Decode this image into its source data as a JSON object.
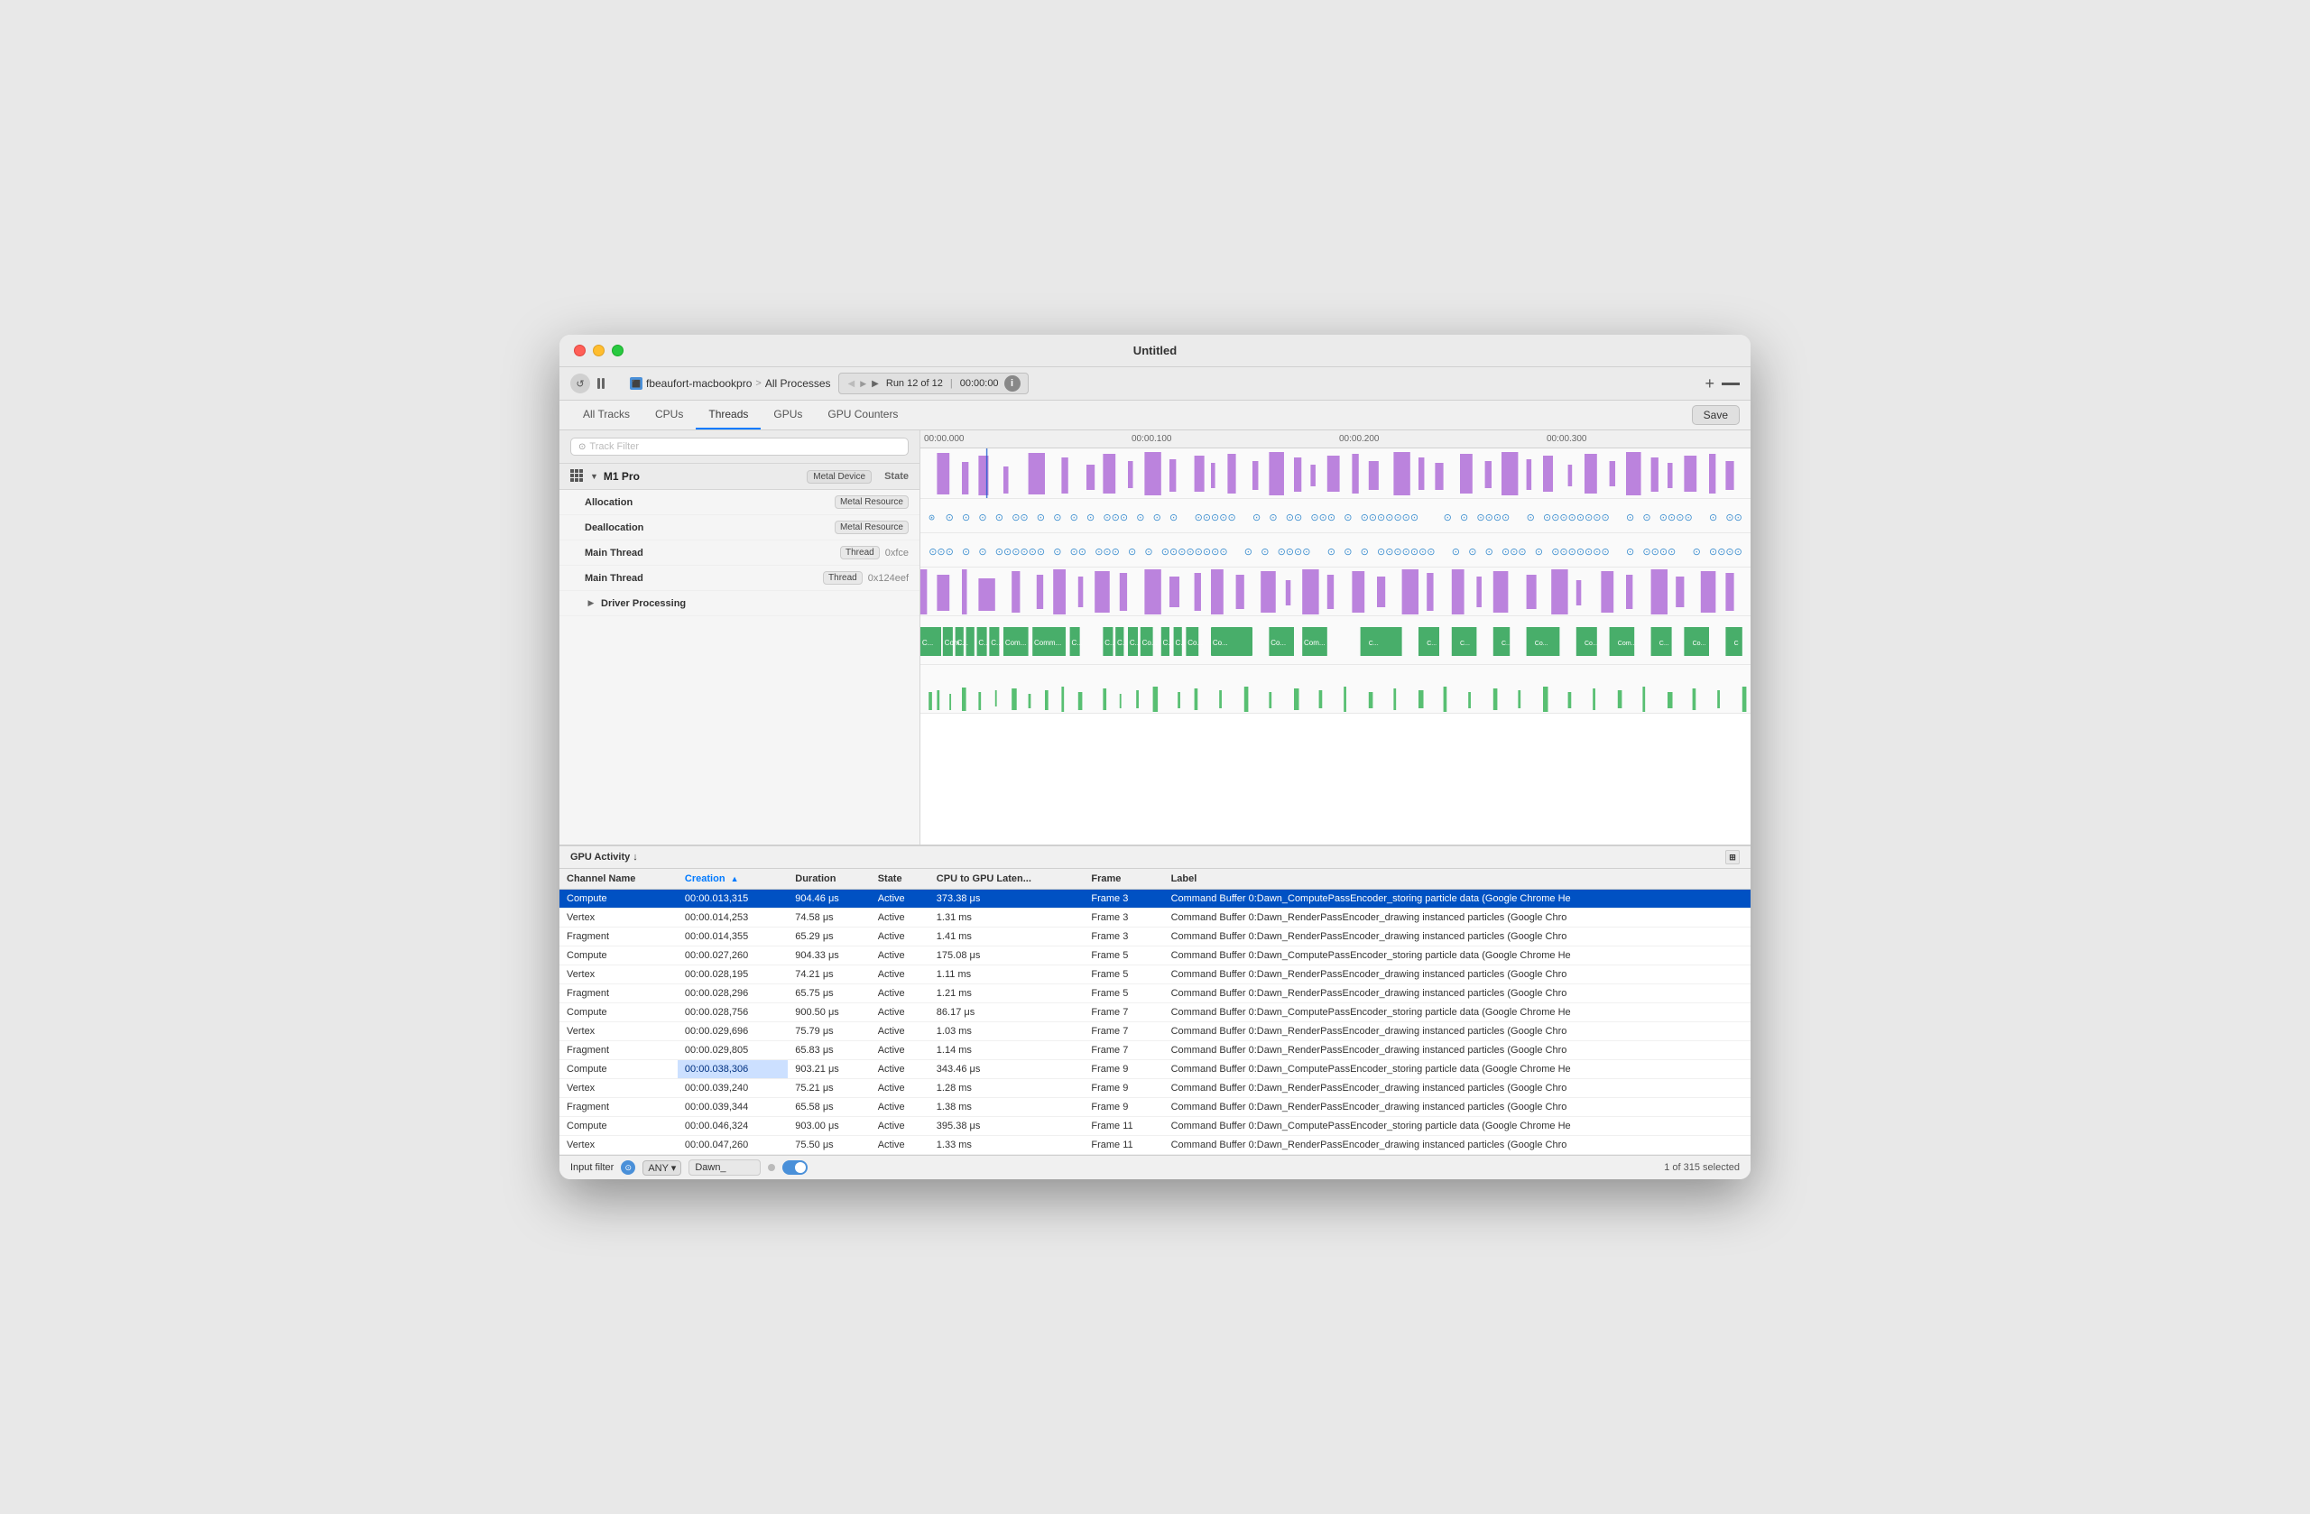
{
  "window": {
    "title": "Untitled"
  },
  "toolbar": {
    "device": "fbeaufort-macbookpro",
    "separator": ">",
    "process": "All Processes",
    "run_nav_left": "◀",
    "run_nav_right": "▶",
    "run_label": "Run 12 of 12",
    "time_label": "00:00:00",
    "plus_label": "+",
    "save_label": "Save"
  },
  "tabs": {
    "items": [
      {
        "label": "All Tracks",
        "active": false
      },
      {
        "label": "CPUs",
        "active": false
      },
      {
        "label": "Threads",
        "active": true
      },
      {
        "label": "GPUs",
        "active": false
      },
      {
        "label": "GPU Counters",
        "active": false
      }
    ]
  },
  "sidebar": {
    "track_filter_placeholder": "Track Filter",
    "state_label": "State",
    "m1_label": "M1 Pro",
    "metal_device_badge": "Metal Device",
    "rows": [
      {
        "title": "Allocation",
        "tag": "Metal Resource",
        "extra": ""
      },
      {
        "title": "Deallocation",
        "tag": "Metal Resource",
        "extra": ""
      },
      {
        "title": "Main Thread",
        "tag": "Thread",
        "extra": "0xfce"
      },
      {
        "title": "Main Thread",
        "tag": "Thread",
        "extra": "0x124eef"
      },
      {
        "title": "Driver Processing",
        "tag": "",
        "extra": ""
      }
    ]
  },
  "timeline": {
    "markers": [
      "00:00.000",
      "00:00.100",
      "00:00.200",
      "00:00.300"
    ]
  },
  "gpu_activity": {
    "title": "GPU Activity ↓"
  },
  "table": {
    "columns": [
      {
        "label": "Channel Name",
        "sort": false
      },
      {
        "label": "Creation",
        "sort": true
      },
      {
        "label": "Duration",
        "sort": false
      },
      {
        "label": "State",
        "sort": false
      },
      {
        "label": "CPU to GPU Laten...",
        "sort": false
      },
      {
        "label": "Frame",
        "sort": false
      },
      {
        "label": "Label",
        "sort": false
      }
    ],
    "rows": [
      {
        "channel": "Compute",
        "creation": "00:00.013,315",
        "duration": "904.46 μs",
        "state": "Active",
        "latency": "373.38 μs",
        "frame": "Frame 3",
        "label": "Command Buffer 0:Dawn_ComputePassEncoder_storing particle data   (Google Chrome He",
        "selected": true,
        "highlight_creation": false
      },
      {
        "channel": "Vertex",
        "creation": "00:00.014,253",
        "duration": "74.58 μs",
        "state": "Active",
        "latency": "1.31 ms",
        "frame": "Frame 3",
        "label": "Command Buffer 0:Dawn_RenderPassEncoder_drawing instanced particles   (Google Chro",
        "selected": false,
        "highlight_creation": false
      },
      {
        "channel": "Fragment",
        "creation": "00:00.014,355",
        "duration": "65.29 μs",
        "state": "Active",
        "latency": "1.41 ms",
        "frame": "Frame 3",
        "label": "Command Buffer 0:Dawn_RenderPassEncoder_drawing instanced particles   (Google Chro",
        "selected": false,
        "highlight_creation": false
      },
      {
        "channel": "Compute",
        "creation": "00:00.027,260",
        "duration": "904.33 μs",
        "state": "Active",
        "latency": "175.08 μs",
        "frame": "Frame 5",
        "label": "Command Buffer 0:Dawn_ComputePassEncoder_storing particle data   (Google Chrome He",
        "selected": false,
        "highlight_creation": false
      },
      {
        "channel": "Vertex",
        "creation": "00:00.028,195",
        "duration": "74.21 μs",
        "state": "Active",
        "latency": "1.11 ms",
        "frame": "Frame 5",
        "label": "Command Buffer 0:Dawn_RenderPassEncoder_drawing instanced particles   (Google Chro",
        "selected": false,
        "highlight_creation": false
      },
      {
        "channel": "Fragment",
        "creation": "00:00.028,296",
        "duration": "65.75 μs",
        "state": "Active",
        "latency": "1.21 ms",
        "frame": "Frame 5",
        "label": "Command Buffer 0:Dawn_RenderPassEncoder_drawing instanced particles   (Google Chro",
        "selected": false,
        "highlight_creation": false
      },
      {
        "channel": "Compute",
        "creation": "00:00.028,756",
        "duration": "900.50 μs",
        "state": "Active",
        "latency": "86.17 μs",
        "frame": "Frame 7",
        "label": "Command Buffer 0:Dawn_ComputePassEncoder_storing particle data   (Google Chrome He",
        "selected": false,
        "highlight_creation": false
      },
      {
        "channel": "Vertex",
        "creation": "00:00.029,696",
        "duration": "75.79 μs",
        "state": "Active",
        "latency": "1.03 ms",
        "frame": "Frame 7",
        "label": "Command Buffer 0:Dawn_RenderPassEncoder_drawing instanced particles   (Google Chro",
        "selected": false,
        "highlight_creation": false
      },
      {
        "channel": "Fragment",
        "creation": "00:00.029,805",
        "duration": "65.83 μs",
        "state": "Active",
        "latency": "1.14 ms",
        "frame": "Frame 7",
        "label": "Command Buffer 0:Dawn_RenderPassEncoder_drawing instanced particles   (Google Chro",
        "selected": false,
        "highlight_creation": false
      },
      {
        "channel": "Compute",
        "creation": "00:00.038,306",
        "duration": "903.21 μs",
        "state": "Active",
        "latency": "343.46 μs",
        "frame": "Frame 9",
        "label": "Command Buffer 0:Dawn_ComputePassEncoder_storing particle data   (Google Chrome He",
        "selected": false,
        "highlight_creation": true
      },
      {
        "channel": "Vertex",
        "creation": "00:00.039,240",
        "duration": "75.21 μs",
        "state": "Active",
        "latency": "1.28 ms",
        "frame": "Frame 9",
        "label": "Command Buffer 0:Dawn_RenderPassEncoder_drawing instanced particles   (Google Chro",
        "selected": false,
        "highlight_creation": false
      },
      {
        "channel": "Fragment",
        "creation": "00:00.039,344",
        "duration": "65.58 μs",
        "state": "Active",
        "latency": "1.38 ms",
        "frame": "Frame 9",
        "label": "Command Buffer 0:Dawn_RenderPassEncoder_drawing instanced particles   (Google Chro",
        "selected": false,
        "highlight_creation": false
      },
      {
        "channel": "Compute",
        "creation": "00:00.046,324",
        "duration": "903.00 μs",
        "state": "Active",
        "latency": "395.38 μs",
        "frame": "Frame 11",
        "label": "Command Buffer 0:Dawn_ComputePassEncoder_storing particle data   (Google Chrome He",
        "selected": false,
        "highlight_creation": false
      },
      {
        "channel": "Vertex",
        "creation": "00:00.047,260",
        "duration": "75.50 μs",
        "state": "Active",
        "latency": "1.33 ms",
        "frame": "Frame 11",
        "label": "Command Buffer 0:Dawn_RenderPassEncoder_drawing instanced particles   (Google Chro",
        "selected": false,
        "highlight_creation": false
      }
    ]
  },
  "filter_bar": {
    "input_label": "Input filter",
    "any_label": "ANY",
    "filter_value": "Dawn_",
    "selection_label": "1 of 315 selected"
  }
}
